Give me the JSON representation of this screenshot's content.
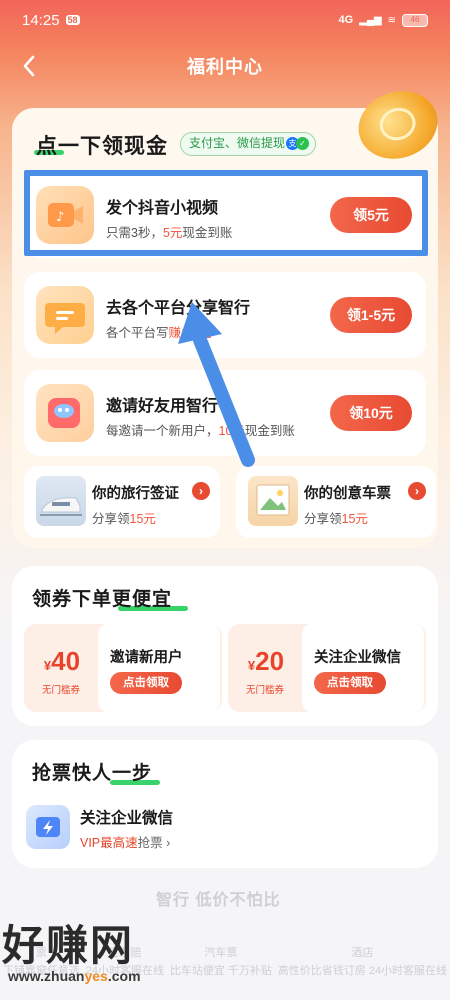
{
  "status_bar": {
    "time": "14:25",
    "badge": "58",
    "network": "4G",
    "battery": "46"
  },
  "nav": {
    "title": "福利中心"
  },
  "cash": {
    "title": "点一下领现金",
    "tag": "支付宝、微信提现",
    "tasks": [
      {
        "title": "发个抖音小视频",
        "sub_prefix": "只需3秒，",
        "sub_highlight": "5元",
        "sub_suffix": "现金到账",
        "button": "领5元"
      },
      {
        "title": "去各个平台分享智行",
        "sub_prefix": "各个平台写",
        "sub_highlight": "赚1-5元",
        "sub_suffix": "",
        "button": "领1-5元"
      },
      {
        "title": "邀请好友用智行",
        "sub_prefix": "每邀请一个新用户，",
        "sub_highlight": "10元",
        "sub_suffix": "现金到账",
        "button": "领10元"
      }
    ],
    "minis": [
      {
        "title": "你的旅行签证",
        "sub_prefix": "分享领",
        "sub_highlight": "15元"
      },
      {
        "title": "你的创意车票",
        "sub_prefix": "分享领",
        "sub_highlight": "15元"
      }
    ]
  },
  "coupons": {
    "title": "领券下单更便宜",
    "items": [
      {
        "currency": "¥",
        "amount": "40",
        "condition": "无门槛券",
        "title": "邀请新用户",
        "button": "点击领取"
      },
      {
        "currency": "¥",
        "amount": "20",
        "condition": "无门槛券",
        "title": "关注企业微信",
        "button": "点击领取"
      }
    ]
  },
  "grab": {
    "title": "抢票快人一步",
    "item_title": "关注企业微信",
    "item_vip": "VIP最高速",
    "item_suffix": "抢票"
  },
  "bottom": {
    "title": "智行 低价不怕比",
    "items": [
      {
        "line1": "票",
        "line2": "下铺靠窗任意选"
      },
      {
        "line1": "定票赔",
        "line2": "24小时客服在线"
      },
      {
        "line1": "汽车票",
        "line2": "比车站便宜 千万补贴"
      },
      {
        "line1": "酒店",
        "line2": "高性价比省钱订房 24小时客服在线"
      }
    ]
  },
  "watermark": {
    "big": "好赚网",
    "url_prefix": "www.zhuan",
    "url_mid": "yes",
    "url_suffix": ".com"
  },
  "colors": {
    "accent": "#e84a32",
    "highlight_box": "#4a8ee8",
    "green_underline": "#39d36c"
  }
}
